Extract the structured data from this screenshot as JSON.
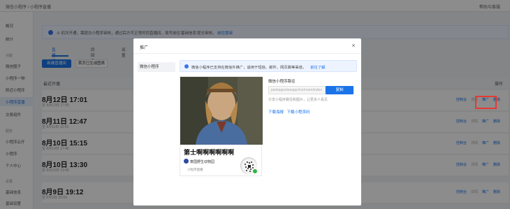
{
  "topbar": {
    "breadcrumb": "微信小程序 / 小程序直播",
    "help": "帮助与客服"
  },
  "sidebar": {
    "items": [
      {
        "label": "概况"
      },
      {
        "label": "统计"
      },
      {
        "label": "功能"
      },
      {
        "label": "微信圈子"
      },
      {
        "label": "小程序一物"
      },
      {
        "label": "附近小程序"
      },
      {
        "label": "小程序直播"
      },
      {
        "label": "交易组件"
      },
      {
        "label": "服务"
      },
      {
        "label": "小程序云开"
      },
      {
        "label": "小程序"
      },
      {
        "label": "个人中心"
      },
      {
        "label": "设置"
      },
      {
        "label": "基础信息"
      },
      {
        "label": "基础设置"
      }
    ]
  },
  "main": {
    "notice": {
      "text": "① 初次开通，需提交小程序审核，通过后方可正常的同直播间，填写前往'基础信息'提交审核。",
      "link": "前往提审"
    },
    "tabs": [
      "直播间",
      "同回看",
      "设置"
    ],
    "buttons": {
      "create": "新建直播间",
      "import": "首页已生成图表"
    },
    "table": {
      "col_title": "最近开播",
      "col_action": "操作"
    },
    "rows": [
      {
        "date": "8月12日 17:01",
        "sub": "至 8月12日 17:05",
        "actions": [
          "控制台",
          "详情",
          "推广",
          "删除"
        ]
      },
      {
        "date": "8月11日 12:47",
        "sub": "至 8月11日 12:51",
        "actions": [
          "控制台",
          "详情",
          "推广",
          "删除"
        ]
      },
      {
        "date": "8月10日 15:15",
        "sub": "至 8月10日 17:46",
        "actions": [
          "控制台",
          "详情",
          "推广",
          "删除"
        ]
      },
      {
        "date": "8月10日 13:30",
        "sub": "至 8月10日 13:46",
        "actions": [
          "控制台",
          "详情",
          "推广",
          "删除"
        ]
      },
      {
        "date": "8月9日 19:12",
        "sub": "至 8月9日 20:00",
        "actions": [
          "控制台",
          "详情",
          "推广",
          "删除"
        ]
      }
    ]
  },
  "modal": {
    "title": "推广",
    "close": "×",
    "side_item": "微信小程序",
    "notice": {
      "text": "微信小程序已支持在微信外推广，适用于短信、邮件、网页跳等渠道。",
      "link": "前往了解"
    },
    "poster": {
      "title": "第士啊啊啊啊啊啊",
      "org": "泰国野生动物园",
      "tag": "小程序直播"
    },
    "path": {
      "label": "微信小程序路径",
      "placeholder": "packages/weapp-live/room/index",
      "copy": "复制",
      "tip": "分享小程序路径和图片，让更多人看见",
      "download_poster": "下载海报",
      "download_code": "下载小程序码"
    }
  }
}
